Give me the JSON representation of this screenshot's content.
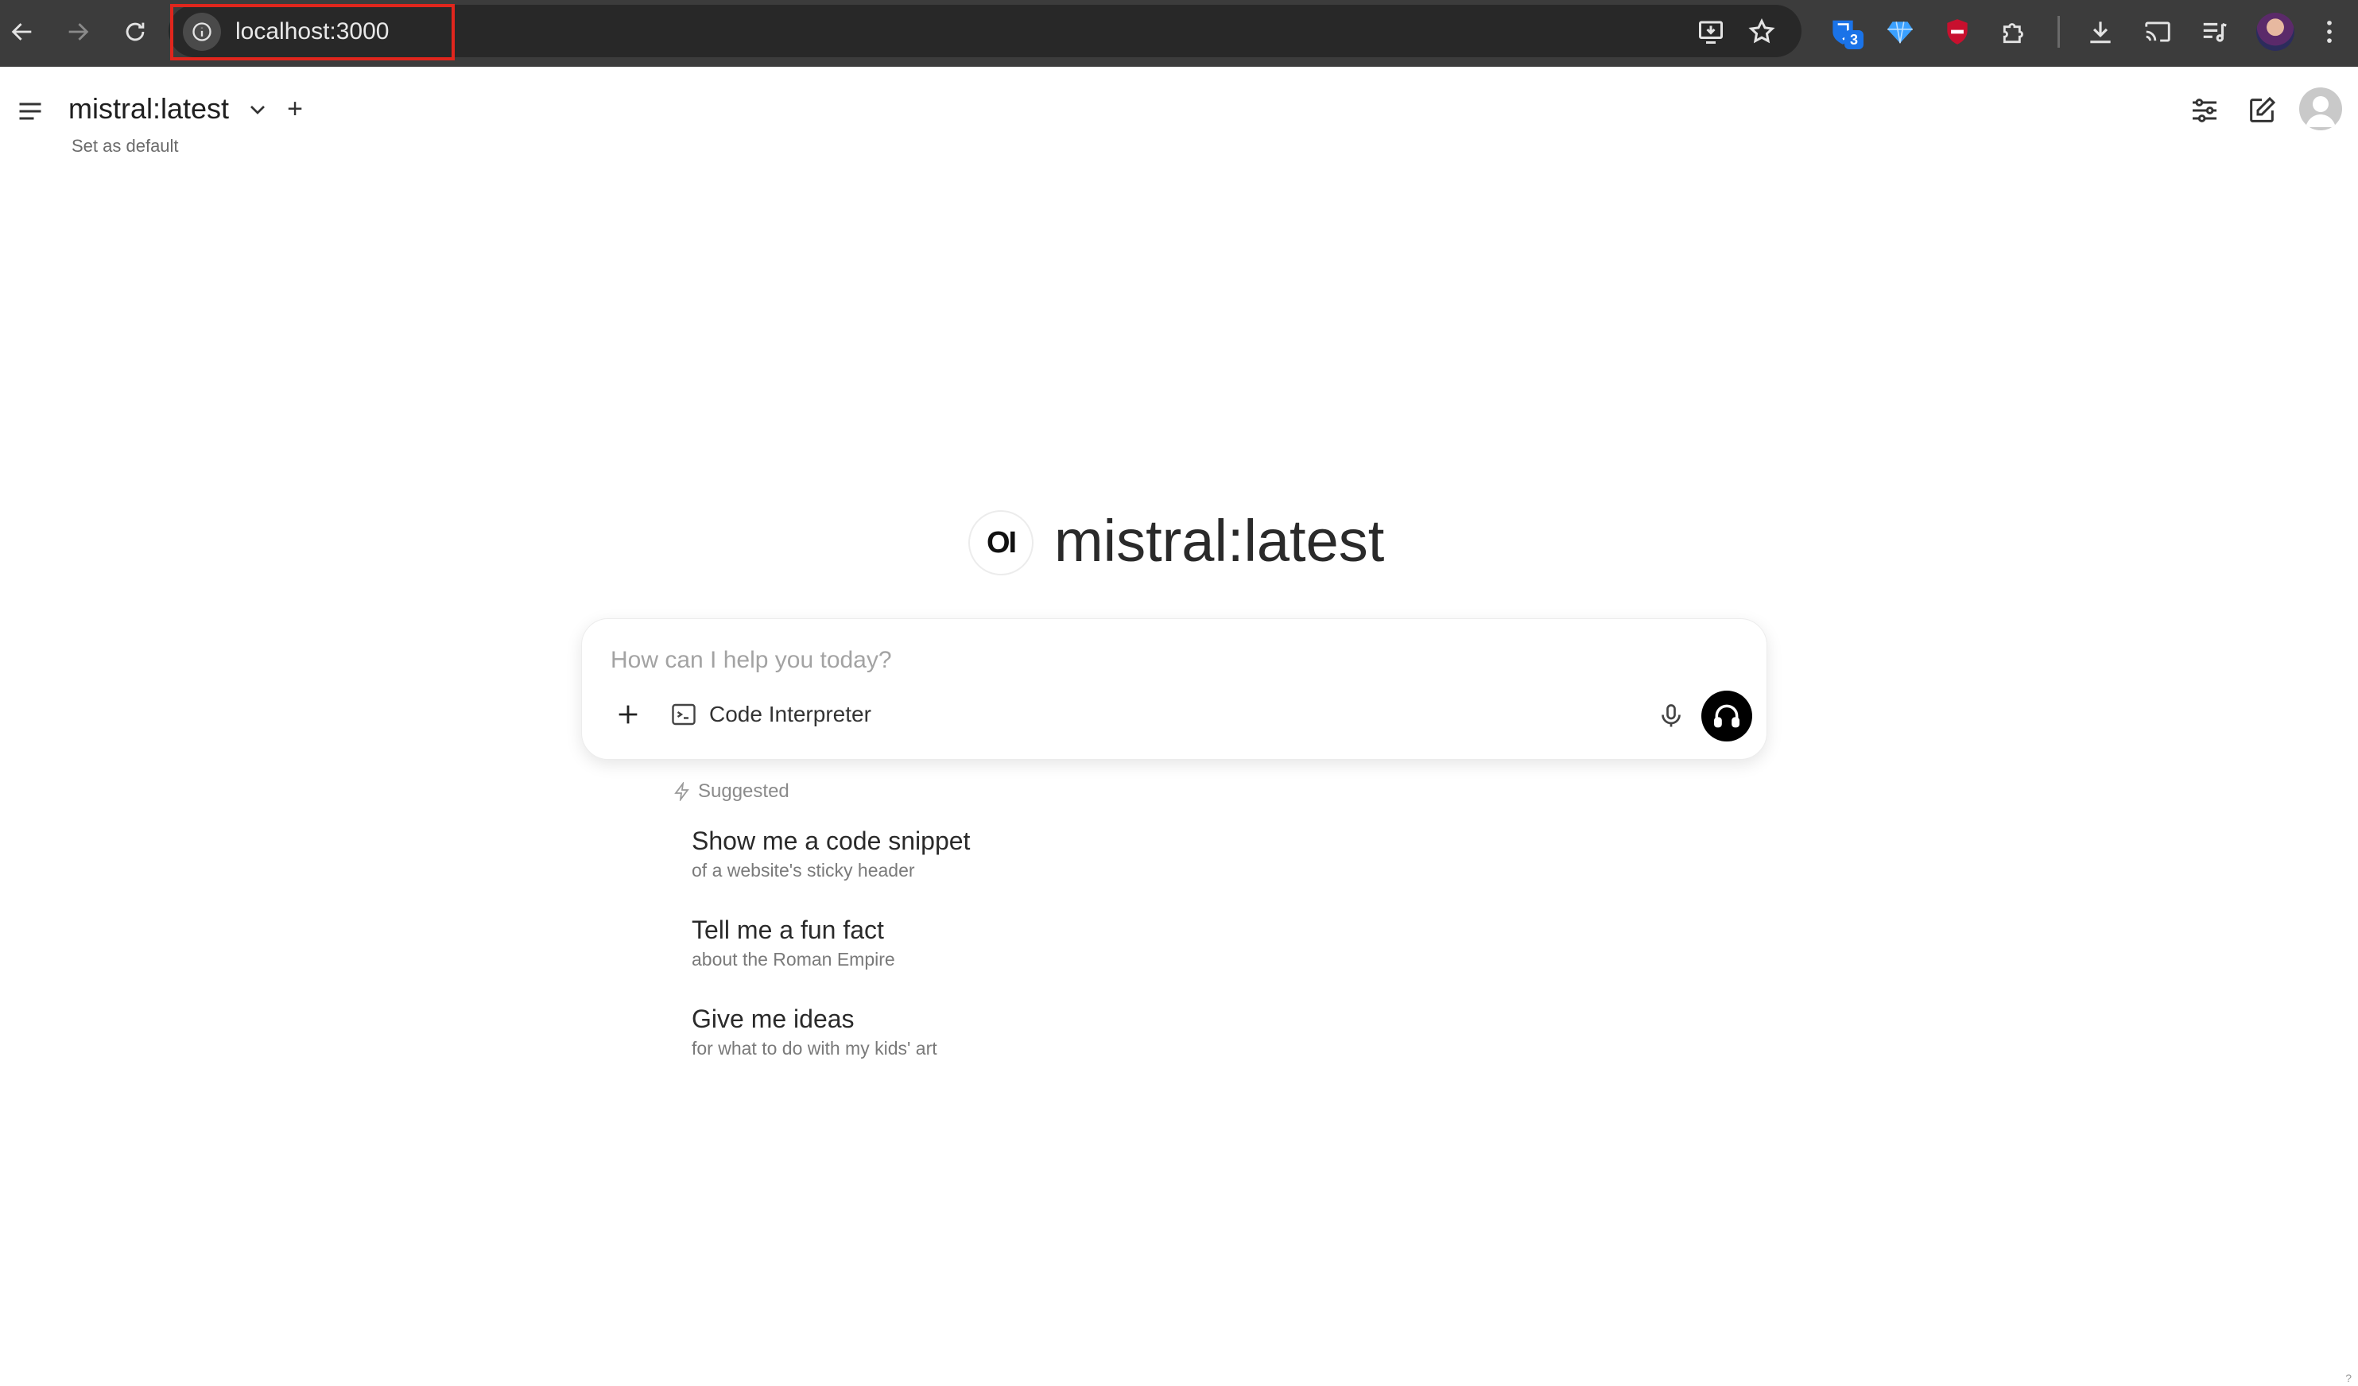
{
  "browser": {
    "url": "localhost:3000",
    "extension_badge": "3",
    "icons": [
      "back-icon",
      "forward-icon",
      "reload-icon",
      "site-info-icon",
      "install-app-icon",
      "bookmark-star-icon",
      "password-manager-extension-icon",
      "gem-extension-icon",
      "ad-blocker-extension-icon",
      "extensions-puzzle-icon",
      "downloads-icon",
      "cast-icon",
      "media-controls-icon",
      "profile-avatar",
      "chrome-menu-icon"
    ]
  },
  "header": {
    "model_name": "mistral:latest",
    "set_default_label": "Set as default",
    "add_model_label": "+"
  },
  "center": {
    "logo_text": "OI",
    "title": "mistral:latest"
  },
  "input": {
    "placeholder": "How can I help you today?",
    "value": "",
    "code_interpreter_label": "Code Interpreter"
  },
  "suggestions": {
    "header": "Suggested",
    "items": [
      {
        "title": "Show me a code snippet",
        "subtitle": "of a website's sticky header"
      },
      {
        "title": "Tell me a fun fact",
        "subtitle": "about the Roman Empire"
      },
      {
        "title": "Give me ideas",
        "subtitle": "for what to do with my kids' art"
      }
    ]
  },
  "footer": {
    "corner_mark": "?"
  },
  "colors": {
    "chrome_bg": "#3c3c3c",
    "omnibox_bg": "#282828",
    "url_highlight": "#e0261d",
    "voice_button": "#000000"
  }
}
